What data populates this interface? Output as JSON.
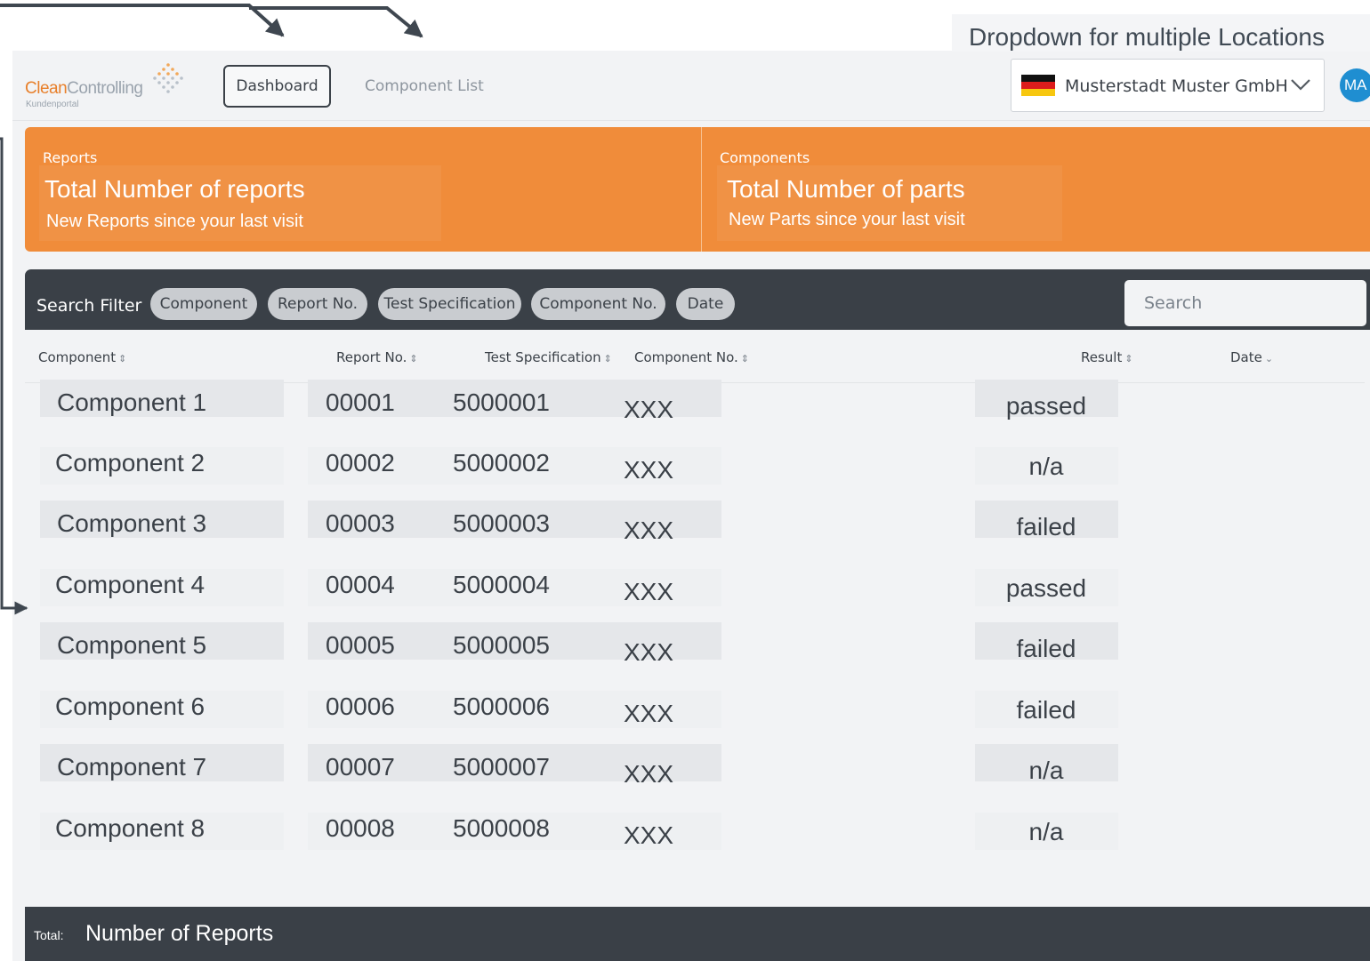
{
  "annotation": {
    "dropdown_note": "Dropdown for multiple Locations"
  },
  "header": {
    "logo_clean": "Clean",
    "logo_controlling": "Controlling",
    "logo_sub": "Kundenportal",
    "nav": {
      "dashboard": "Dashboard",
      "component_list": "Component List"
    },
    "location": "Musterstadt Muster GmbH",
    "avatar": "MA"
  },
  "stats": {
    "reports": {
      "caption": "Reports",
      "title": "Total Number of reports",
      "subtitle": "New Reports since your last visit"
    },
    "components": {
      "caption": "Components",
      "title": "Total Number of parts",
      "subtitle": "New Parts since your last visit"
    }
  },
  "filter": {
    "label": "Search Filter",
    "chips": [
      "Component",
      "Report No.",
      "Test Specification",
      "Component No.",
      "Date"
    ],
    "search_placeholder": "Search"
  },
  "table": {
    "headers": [
      "Component",
      "Report No.",
      "Test Specification",
      "Component No.",
      "Result",
      "Date"
    ],
    "rows": [
      {
        "component": "Component 1",
        "report_no": "00001",
        "test_spec": "5000001",
        "component_no": "XXX",
        "result": "passed"
      },
      {
        "component": "Component 2",
        "report_no": "00002",
        "test_spec": "5000002",
        "component_no": "XXX",
        "result": "n/a"
      },
      {
        "component": "Component 3",
        "report_no": "00003",
        "test_spec": "5000003",
        "component_no": "XXX",
        "result": "failed"
      },
      {
        "component": "Component 4",
        "report_no": "00004",
        "test_spec": "5000004",
        "component_no": "XXX",
        "result": "passed"
      },
      {
        "component": "Component 5",
        "report_no": "00005",
        "test_spec": "5000005",
        "component_no": "XXX",
        "result": "failed"
      },
      {
        "component": "Component 6",
        "report_no": "00006",
        "test_spec": "5000006",
        "component_no": "XXX",
        "result": "failed"
      },
      {
        "component": "Component 7",
        "report_no": "00007",
        "test_spec": "5000007",
        "component_no": "XXX",
        "result": "n/a"
      },
      {
        "component": "Component 8",
        "report_no": "00008",
        "test_spec": "5000008",
        "component_no": "XXX",
        "result": "n/a"
      }
    ]
  },
  "footer": {
    "label": "Total:",
    "value": "Number of Reports"
  },
  "colors": {
    "accent": "#f08c3a",
    "dark": "#3a4047",
    "avatar": "#1f8ed1",
    "background": "#f2f3f5"
  }
}
